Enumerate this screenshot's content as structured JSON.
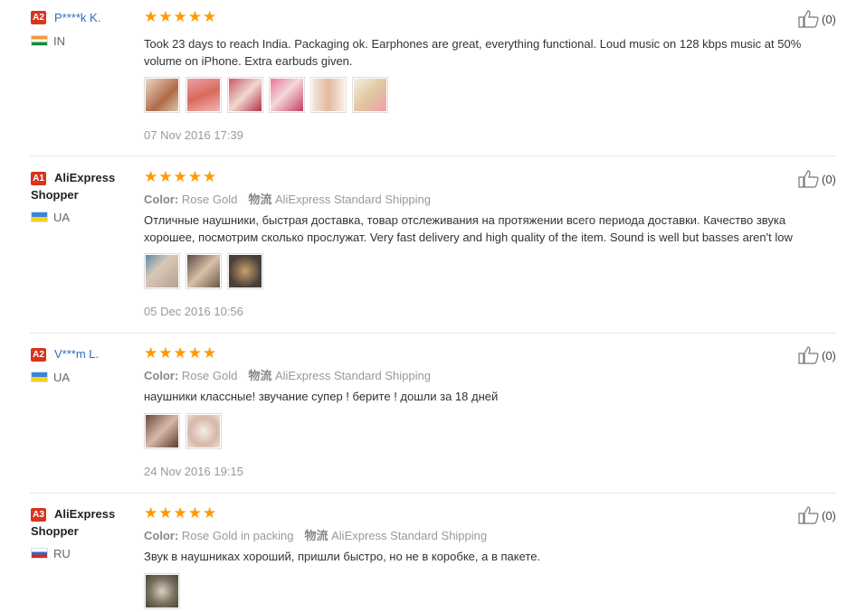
{
  "reviews": [
    {
      "badge": "A2",
      "name": "P****k K.",
      "country": "IN",
      "text": "Took 23 days to reach India. Packaging ok. Earphones are great, everything functional. Loud music on 128 kbps music at 50% volume on iPhone. Extra earbuds given.",
      "date": "07 Nov 2016 17:39",
      "helpful": "(0)"
    },
    {
      "badge": "A1",
      "name": "AliExpress Shopper",
      "country": "UA",
      "color_label": "Color:",
      "color_value": "Rose Gold",
      "ship_label": "物流",
      "ship_value": "AliExpress Standard Shipping",
      "text": "Отличные наушники, быстрая доставка, товар отслеживания на протяжении всего периода доставки. Качество звука хорошее, посмотрим сколько прослужат. Very fast delivery and high quality of the item. Sound is well but basses aren't low",
      "date": "05 Dec 2016 10:56",
      "helpful": "(0)"
    },
    {
      "badge": "A2",
      "name": "V***m L.",
      "country": "UA",
      "color_label": "Color:",
      "color_value": "Rose Gold",
      "ship_label": "物流",
      "ship_value": "AliExpress Standard Shipping",
      "text": "наушники классные! звучание супер ! берите ! дошли за 18 дней",
      "date": "24 Nov 2016 19:15",
      "helpful": "(0)"
    },
    {
      "badge": "A3",
      "name": "AliExpress Shopper",
      "country": "RU",
      "color_label": "Color:",
      "color_value": "Rose Gold in packing",
      "ship_label": "物流",
      "ship_value": "AliExpress Standard Shipping",
      "text": "Звук в наушниках хороший, пришли быстро, но не в коробке, а в пакете.",
      "helpful": "(0)"
    }
  ],
  "icons": {
    "stars": "five-star-rating",
    "helpful": "thumbs-up-icon"
  },
  "colors": {
    "accent_link": "#2a6ebf",
    "badge": "#d8341f",
    "star": "#ff9a00"
  }
}
